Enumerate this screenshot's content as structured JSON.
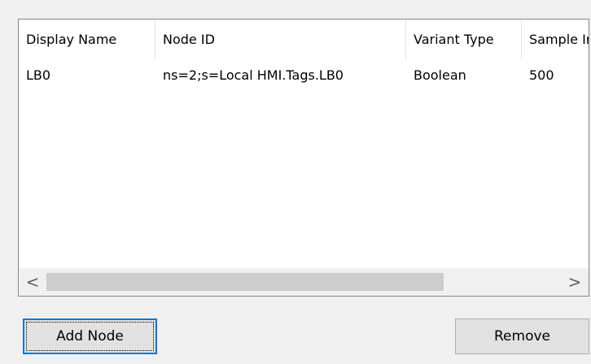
{
  "table": {
    "columns": [
      {
        "label": "Display Name"
      },
      {
        "label": "Node ID"
      },
      {
        "label": "Variant Type"
      },
      {
        "label": "Sample Ir"
      }
    ],
    "rows": [
      {
        "display_name": "LB0",
        "node_id": "ns=2;s=Local HMI.Tags.LB0",
        "variant_type": "Boolean",
        "sample_interval": "500"
      }
    ]
  },
  "scrollbar": {
    "left_arrow": "<",
    "right_arrow": ">"
  },
  "buttons": {
    "add_node": "Add Node",
    "remove": "Remove"
  }
}
